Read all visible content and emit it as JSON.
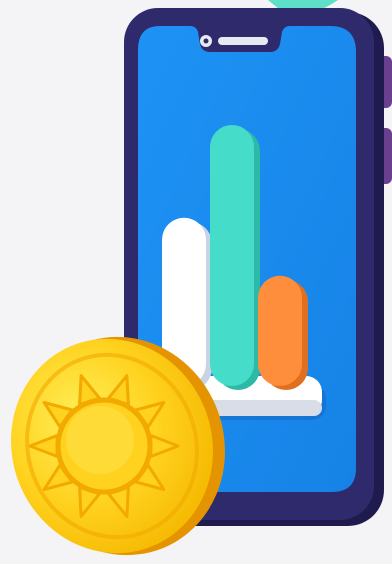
{
  "illustration": {
    "colors": {
      "background": "#f4f4f6",
      "corner_accent": "#5ee0c8",
      "phone_frame": "#2e2a6b",
      "phone_frame_side": "#1f1b4e",
      "phone_screen": "#1e8ff2",
      "side_buttons": "#6a3f8e",
      "bar_white": "#ffffff",
      "bar_teal": "#45dcc9",
      "bar_orange": "#ff8e3c",
      "coin_gold": "#ffd21f",
      "coin_shadow": "#f2a900",
      "coin_edge": "#e49400"
    },
    "bars": [
      {
        "name": "white",
        "level": 0.58
      },
      {
        "name": "teal",
        "level": 0.9
      },
      {
        "name": "orange",
        "level": 0.38
      }
    ],
    "icons": {
      "phone": "smartphone-icon",
      "chart": "bar-chart-icon",
      "coin": "sun-coin-icon"
    }
  }
}
